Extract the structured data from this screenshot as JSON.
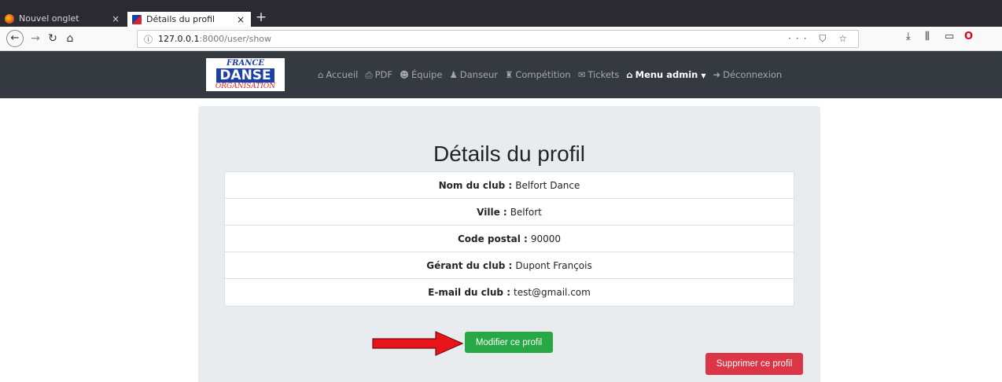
{
  "browser": {
    "tabs": [
      {
        "label": "Nouvel onglet",
        "close": "×"
      },
      {
        "label": "Détails du profil",
        "close": "×"
      }
    ],
    "new_tab": "+",
    "url": {
      "info": "ⓘ",
      "host": "127.0.0.1",
      "path": ":8000/user/show"
    },
    "url_actions": "··· ⛉ ☆",
    "nav": {
      "back": "←",
      "forward": "→",
      "reload": "↻",
      "home": "⌂"
    },
    "tools": {
      "download": "⤓",
      "library": "⫼",
      "sidebar": "▭",
      "opera": "O"
    }
  },
  "site": {
    "logo": {
      "line1": "FRANCE",
      "line2": "DANSE",
      "line3": "ORGANISATION"
    },
    "menu": [
      {
        "icon": "⌂",
        "label": "Accueil"
      },
      {
        "icon": "⎙",
        "label": "PDF"
      },
      {
        "icon": "☻",
        "label": "Équipe"
      },
      {
        "icon": "♟",
        "label": "Danseur"
      },
      {
        "icon": "♜",
        "label": "Compétition"
      },
      {
        "icon": "✉",
        "label": "Tickets"
      },
      {
        "icon": "⌂",
        "label": "Menu admin",
        "caret": "▼"
      },
      {
        "icon": "➜",
        "label": "Déconnexion"
      }
    ]
  },
  "profile": {
    "title": "Détails du profil",
    "fields": [
      {
        "label": "Nom du club :",
        "value": "Belfort Dance"
      },
      {
        "label": "Ville :",
        "value": "Belfort"
      },
      {
        "label": "Code postal :",
        "value": "90000"
      },
      {
        "label": "Gérant du club :",
        "value": "Dupont François"
      },
      {
        "label": "E-mail du club :",
        "value": "test@gmail.com"
      }
    ],
    "edit_button": "Modifier ce profil",
    "delete_button": "Supprimer ce profil"
  },
  "colors": {
    "navbar": "#343a40",
    "jumbotron": "#e9ecef",
    "edit": "#28a745",
    "delete": "#dc3545",
    "arrow": "#e8141b"
  }
}
